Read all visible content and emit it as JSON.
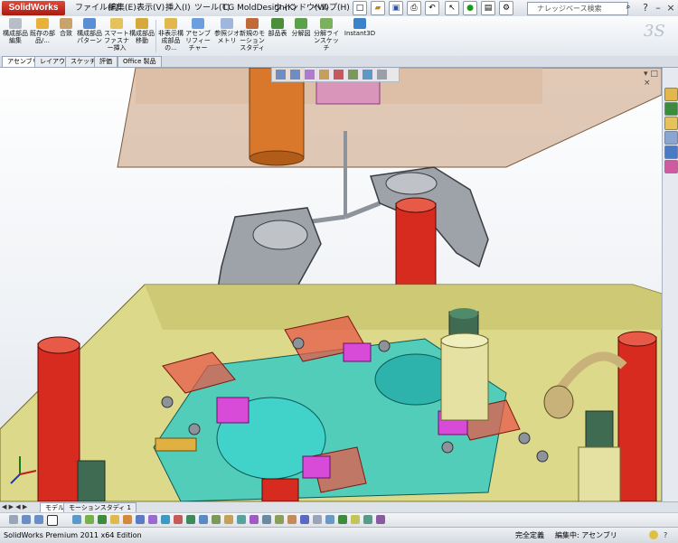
{
  "app": {
    "logo": "SolidWorks"
  },
  "menu": {
    "items": [
      "ファイル(F)",
      "編集(E)",
      "表示(V)",
      "挿入(I)",
      "ツール(T)",
      "CG MoldDesign(K)",
      "ウィンドウ(W)",
      "ヘルプ(H)"
    ]
  },
  "search": {
    "placeholder": "ナレッジベース検索"
  },
  "ribbon": {
    "buttons": [
      {
        "label": "構成部品編集",
        "icon": "edit-component-icon"
      },
      {
        "label": "既存の部品/...",
        "icon": "insert-component-icon"
      },
      {
        "label": "合致",
        "icon": "mate-icon"
      },
      {
        "label": "構成部品パターン",
        "icon": "component-pattern-icon"
      },
      {
        "label": "スマートファスナー挿入",
        "icon": "smart-fastener-icon"
      },
      {
        "label": "構成部品移動",
        "icon": "move-component-icon"
      },
      {
        "label": "非表示構成部品の...",
        "icon": "hide-component-icon"
      },
      {
        "label": "アセンブリフィーチャー",
        "icon": "assembly-feature-icon"
      },
      {
        "label": "参照ジオメトリ",
        "icon": "reference-geometry-icon"
      },
      {
        "label": "新規のモーションスタディ",
        "icon": "motion-study-icon"
      },
      {
        "label": "部品表",
        "icon": "bom-icon"
      },
      {
        "label": "分解図",
        "icon": "exploded-view-icon"
      },
      {
        "label": "分解ラインスケッチ",
        "icon": "explode-line-icon"
      },
      {
        "label": "Instant3D",
        "icon": "instant3d-icon"
      }
    ]
  },
  "tabs": {
    "items": [
      "アセンブリ",
      "レイアウト",
      "スケッチ",
      "評価",
      "Office 製品"
    ],
    "active": "アセンブリ"
  },
  "bottom_tabs": {
    "items": [
      "モデル",
      "モーションスタディ 1"
    ]
  },
  "status": {
    "product": "SolidWorks Premium 2011 x64 Edition",
    "state": "完全定義",
    "editing": "編集中: アセンブリ"
  },
  "colors": {
    "ribbon_accent": "#2a5ea8",
    "plate": "#ddd98a",
    "pin_red": "#d62b1e",
    "cavity_cyan": "#2ec9c6",
    "block_magenta": "#d84ad8"
  }
}
